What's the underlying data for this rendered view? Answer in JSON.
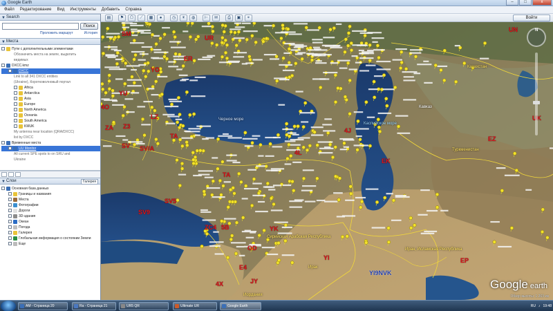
{
  "window": {
    "title": "Google Earth",
    "close_label": "x",
    "min_label": "–",
    "max_label": "□"
  },
  "menu": [
    "Файл",
    "Редактирование",
    "Вид",
    "Инструменты",
    "Добавить",
    "Справка"
  ],
  "toolbar": {
    "login_label": "Войти"
  },
  "search": {
    "title": "Search",
    "button": "Поиск",
    "link_route": "Проложить маршрут",
    "link_history": "История",
    "value": ""
  },
  "places": {
    "title": "Места",
    "items": [
      {
        "text": "Пути с дополнительными элементами",
        "cls": "",
        "color": "#e9c43a"
      },
      {
        "text": "Обозначить места на земле, выделить",
        "cls": "desc"
      },
      {
        "text": "видимых",
        "cls": "desc"
      },
      {
        "text": "DXCC.kmz",
        "cls": "",
        "color": "#3b6fb6"
      },
      {
        "text": "DXCC",
        "cls": "sub link sel",
        "color": "#3b6fb6"
      },
      {
        "text": "Link to all 341 DXCC entities",
        "cls": "desc"
      },
      {
        "text": "(Ukraine), Коротковолновый портал",
        "cls": "desc"
      },
      {
        "text": "Africa",
        "cls": "sub2",
        "color": "#e9c43a"
      },
      {
        "text": "Antarctica",
        "cls": "sub2",
        "color": "#e9c43a"
      },
      {
        "text": "Asia",
        "cls": "sub2",
        "color": "#e9c43a"
      },
      {
        "text": "Europe",
        "cls": "sub2",
        "color": "#e9c43a"
      },
      {
        "text": "North America",
        "cls": "sub2",
        "color": "#e9c43a"
      },
      {
        "text": "Oceania",
        "cls": "sub2",
        "color": "#e9c43a"
      },
      {
        "text": "South America",
        "cls": "sub2",
        "color": "#e9c43a"
      },
      {
        "text": "KMUK",
        "cls": "sub2",
        "color": "#e9c43a"
      },
      {
        "text": "My antenna near location (QRA/DXCC)",
        "cls": "desc"
      },
      {
        "text": "list by DXCC",
        "cls": "desc"
      },
      {
        "text": "Временные места",
        "cls": "",
        "color": "#3b6fb6"
      },
      {
        "text": "UU Monitor",
        "cls": "sub link sel",
        "color": "#3b6fb6"
      },
      {
        "text": "All current SPE spots to on SRU and",
        "cls": "desc"
      },
      {
        "text": "Ukraine",
        "cls": "desc"
      }
    ]
  },
  "layers": {
    "title": "Слои",
    "gallery": "Галерея",
    "items": [
      {
        "text": "Основная база данных",
        "color": "#3b6fb6"
      },
      {
        "text": "Границы и названия",
        "color": "#e9c43a"
      },
      {
        "text": "Места",
        "color": "#9b6b3a"
      },
      {
        "text": "Фотографии",
        "color": "#3b8fd0"
      },
      {
        "text": "Дороги",
        "color": "#e2e2e2"
      },
      {
        "text": "3D-здания",
        "color": "#8b8b8b"
      },
      {
        "text": "Океан",
        "color": "#2b6cc4"
      },
      {
        "text": "Погода",
        "color": "#bfbfbf"
      },
      {
        "text": "Галерея",
        "color": "#e9c43a"
      },
      {
        "text": "Глобальная информация о состоянии Земли",
        "color": "#2c8f43"
      },
      {
        "text": "Еще",
        "color": "#bbbbbb"
      }
    ]
  },
  "map": {
    "callsigns": [
      {
        "t": "UN",
        "c": "red"
      },
      {
        "t": "SM",
        "c": "red"
      },
      {
        "t": "UR",
        "c": "red"
      },
      {
        "t": "ER",
        "c": "red"
      },
      {
        "t": "YO",
        "c": "red"
      },
      {
        "t": "YU",
        "c": "red"
      },
      {
        "t": "4O",
        "c": "red"
      },
      {
        "t": "Z3",
        "c": "red"
      },
      {
        "t": "LZ",
        "c": "red"
      },
      {
        "t": "ZA",
        "c": "red"
      },
      {
        "t": "SV",
        "c": "red"
      },
      {
        "t": "TA",
        "c": "red"
      },
      {
        "t": "SV/A",
        "c": "red"
      },
      {
        "t": "TA",
        "c": "red"
      },
      {
        "t": "4L",
        "c": "red"
      },
      {
        "t": "EK",
        "c": "red"
      },
      {
        "t": "4J",
        "c": "red"
      },
      {
        "t": "UK",
        "c": "red"
      },
      {
        "t": "EZ",
        "c": "red"
      },
      {
        "t": "SV5",
        "c": "red"
      },
      {
        "t": "SV9",
        "c": "red"
      },
      {
        "t": "ZC4",
        "c": "red"
      },
      {
        "t": "5B",
        "c": "red"
      },
      {
        "t": "YK",
        "c": "red"
      },
      {
        "t": "OD",
        "c": "red"
      },
      {
        "t": "E4",
        "c": "red"
      },
      {
        "t": "4X",
        "c": "red"
      },
      {
        "t": "JY",
        "c": "red"
      },
      {
        "t": "YI",
        "c": "red"
      },
      {
        "t": "EP",
        "c": "red"
      },
      {
        "t": "YI9NVK",
        "c": "blue"
      }
    ],
    "places": [
      {
        "t": "Черное море",
        "k": "sea"
      },
      {
        "t": "Казахстан",
        "k": "country"
      },
      {
        "t": "Туркменистан",
        "k": "country"
      },
      {
        "t": "Каспийское море",
        "k": "bluelab"
      },
      {
        "t": "Сирийская Арабская Республика",
        "k": "country"
      },
      {
        "t": "Ирак",
        "k": "country"
      },
      {
        "t": "Иран, Исламская Республика",
        "k": "country"
      },
      {
        "t": "Иордания",
        "k": "country"
      },
      {
        "t": "Кавказ",
        "k": ""
      }
    ],
    "logo_main": "Google",
    "logo_sub": " earth",
    "status": "Обзор высоты: 1 263 км",
    "compass_n": "N"
  },
  "taskbar": {
    "tasks": [
      {
        "text": "АМ - Страница 20",
        "color": "#3b6fb6"
      },
      {
        "text": "Ra - Страница 21",
        "color": "#4a78c0"
      },
      {
        "text": "UR5 QR",
        "color": "#888888"
      },
      {
        "text": "Ultimate UR",
        "color": "#cc5a2a"
      },
      {
        "text": "Google Earth",
        "color": "#3b6fb6"
      }
    ],
    "lang": "RU",
    "clock": "19:48"
  }
}
